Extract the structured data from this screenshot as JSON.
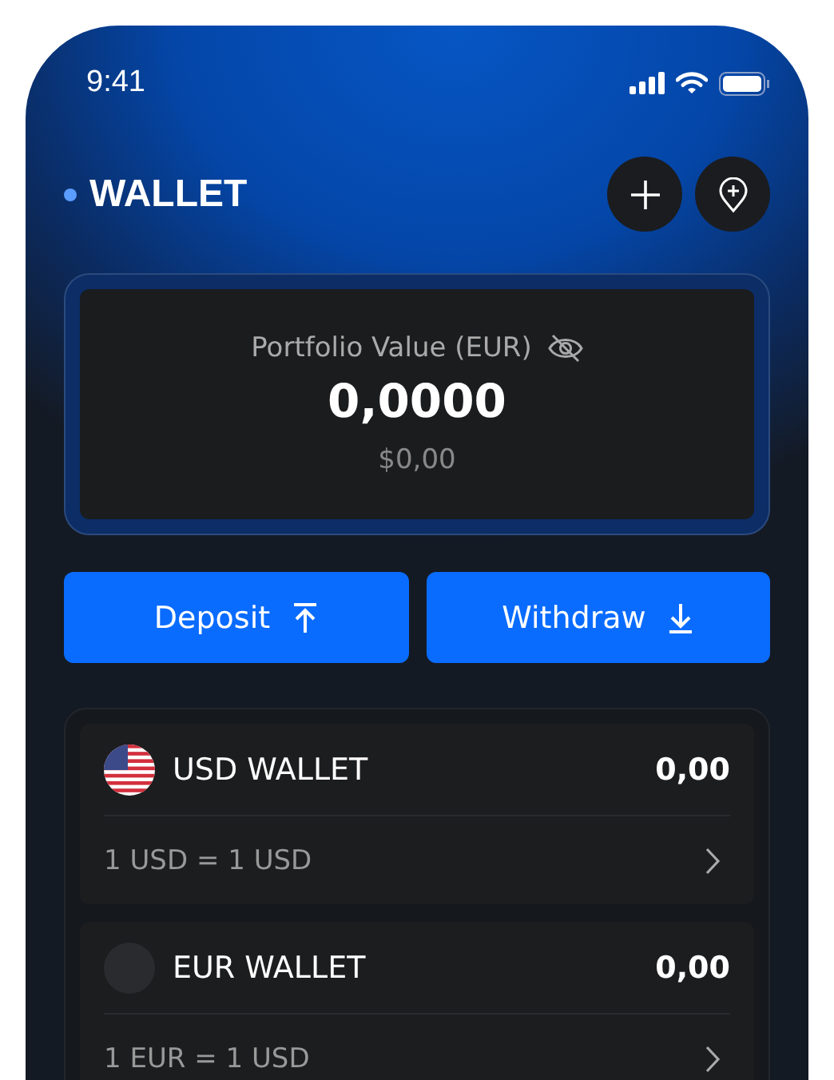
{
  "status_bar": {
    "time": "9:41"
  },
  "header": {
    "title": "WALLET"
  },
  "portfolio": {
    "label": "Portfolio Value (EUR)",
    "value": "0,0000",
    "usd_value": "$0,00"
  },
  "actions": [
    {
      "label": "Deposit",
      "kind": "up"
    },
    {
      "label": "Withdraw",
      "kind": "down"
    }
  ],
  "wallets": [
    {
      "name": "USD WALLET",
      "balance": "0,00",
      "rate": "1 USD = 1 USD",
      "kind": "flag"
    },
    {
      "name": "EUR WALLET",
      "balance": "0,00",
      "rate": "1 EUR = 1 USD",
      "kind": "placeholder"
    }
  ]
}
